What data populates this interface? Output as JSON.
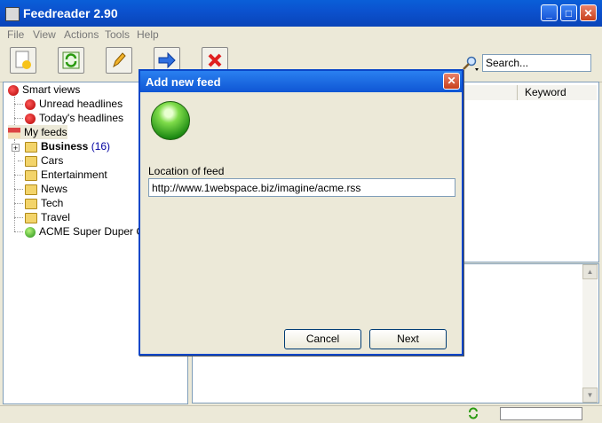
{
  "window": {
    "title": "Feedreader 2.90"
  },
  "menu": [
    "File",
    "View",
    "Actions",
    "Tools",
    "Help"
  ],
  "toolbar": {
    "buttons": [
      "new-feed-icon",
      "refresh-icon",
      "edit-icon",
      "forward-icon",
      "delete-icon"
    ],
    "search_value": "Search..."
  },
  "tree": {
    "smart_views": "Smart views",
    "unread": "Unread headlines",
    "today": "Today's headlines",
    "my_feeds": "My feeds",
    "business": "Business",
    "business_count": "(16)",
    "folders": [
      "Cars",
      "Entertainment",
      "News",
      "Tech",
      "Travel"
    ],
    "acme": "ACME Super Duper Glu"
  },
  "list": {
    "keyword_header": "Keyword"
  },
  "dialog": {
    "title": "Add new feed",
    "close": "✕",
    "location_label": "Location of feed",
    "location_value": "http://www.1webspace.biz/imagine/acme.rss",
    "cancel": "Cancel",
    "next": "Next"
  },
  "colors": {
    "title_blue": "#0b52cf",
    "feed_green": "#1d8a13"
  }
}
